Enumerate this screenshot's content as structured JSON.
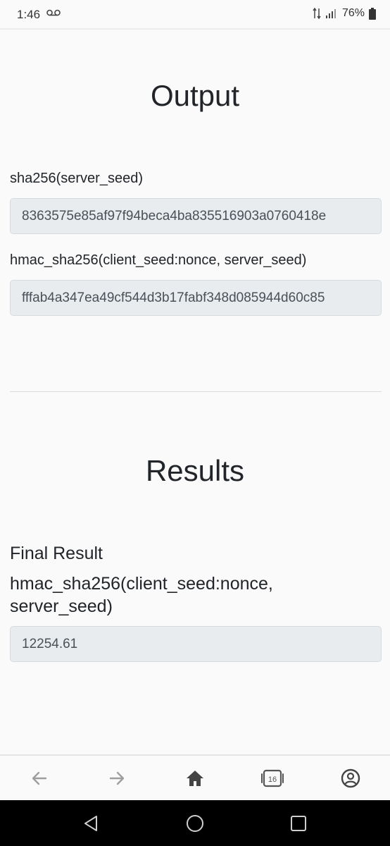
{
  "status_bar": {
    "time": "1:46",
    "battery": "76%",
    "icons": [
      "voicemail-icon",
      "data-arrows-icon",
      "signal-icon",
      "battery-icon"
    ]
  },
  "output": {
    "title": "Output",
    "fields": [
      {
        "label": "sha256(server_seed)",
        "value": "8363575e85af97f94beca4ba835516903a0760418e"
      },
      {
        "label": "hmac_sha256(client_seed:nonce, server_seed)",
        "value": "fffab4a347ea49cf544d3b17fabf348d085944d60c85"
      }
    ]
  },
  "results": {
    "title": "Results",
    "final_result_label": "Final Result",
    "field_heading_line1": "hmac_sha256(client_seed:nonce,",
    "field_heading_line2": "server_seed)",
    "value": "12254.61"
  },
  "browser_nav": {
    "tab_count": "16",
    "icons": [
      "back-arrow-icon",
      "forward-arrow-icon",
      "home-icon",
      "tabs-icon",
      "account-icon"
    ]
  },
  "system_nav": {
    "icons": [
      "back-triangle-icon",
      "home-circle-icon",
      "recents-square-icon"
    ]
  }
}
